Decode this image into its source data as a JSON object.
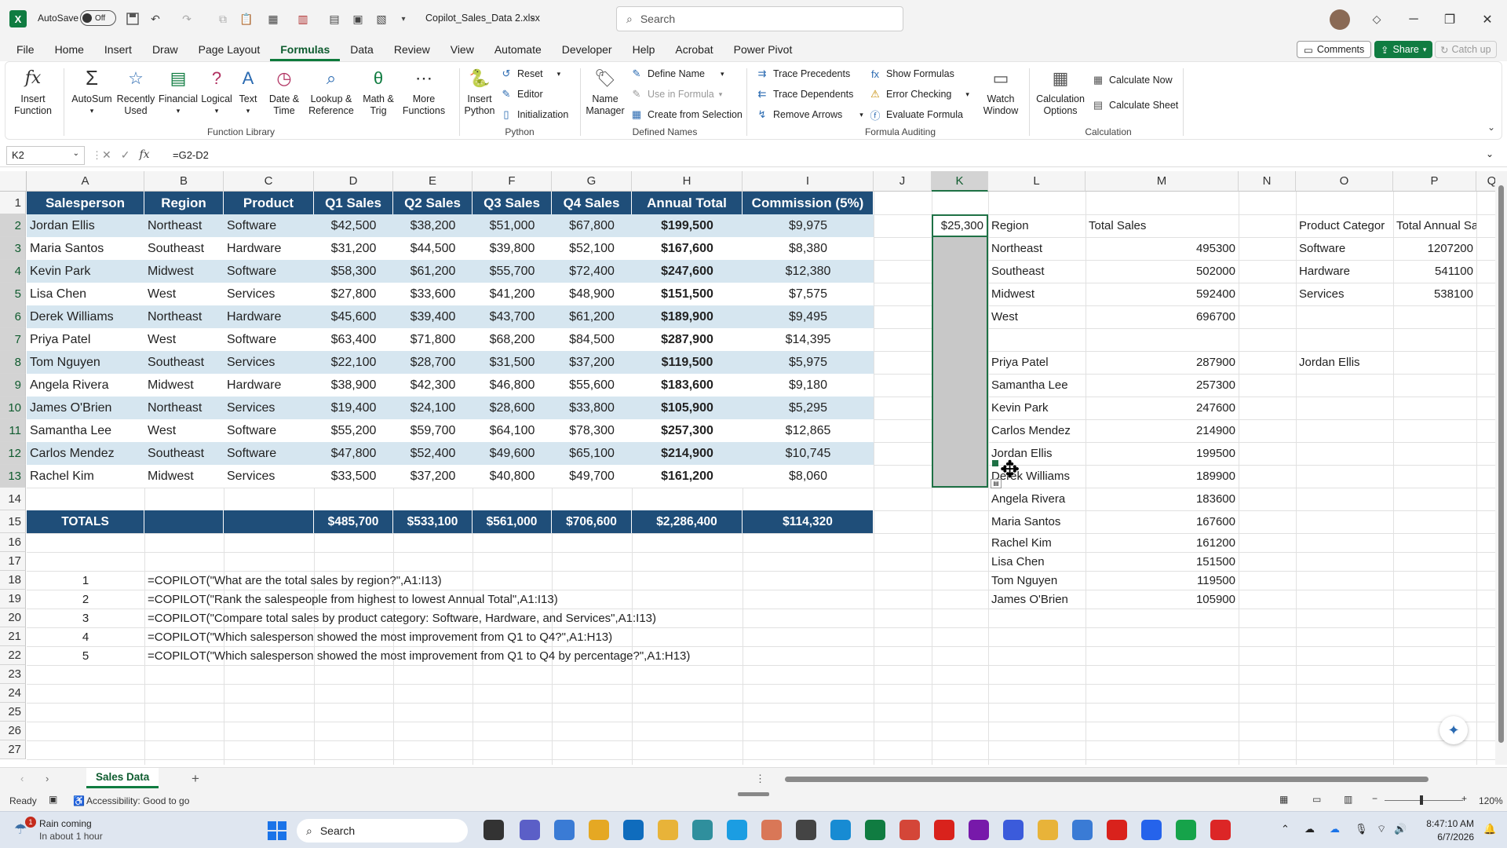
{
  "titlebar": {
    "autosave_label": "AutoSave",
    "autosave_state": "Off",
    "filename": "Copilot_Sales_Data 2.xlsx",
    "search_placeholder": "Search"
  },
  "menu": {
    "tabs": [
      "File",
      "Home",
      "Insert",
      "Draw",
      "Page Layout",
      "Formulas",
      "Data",
      "Review",
      "View",
      "Automate",
      "Developer",
      "Help",
      "Acrobat",
      "Power Pivot"
    ],
    "active": "Formulas",
    "comments": "Comments",
    "share": "Share",
    "catchup": "Catch up"
  },
  "ribbon": {
    "insert_function": [
      "Insert",
      "Function"
    ],
    "autosum": "AutoSum",
    "recently_used": [
      "Recently",
      "Used"
    ],
    "financial": "Financial",
    "logical": "Logical",
    "text": "Text",
    "date_time": [
      "Date &",
      "Time"
    ],
    "lookup": [
      "Lookup &",
      "Reference"
    ],
    "math": [
      "Math &",
      "Trig"
    ],
    "more_functions": [
      "More",
      "Functions"
    ],
    "group_function_library": "Function Library",
    "insert_python": [
      "Insert",
      "Python"
    ],
    "reset": "Reset",
    "editor": "Editor",
    "initialization": "Initialization",
    "group_python": "Python",
    "name_manager": [
      "Name",
      "Manager"
    ],
    "define_name": "Define Name",
    "use_in_formula": "Use in Formula",
    "create_from_selection": "Create from Selection",
    "group_defined_names": "Defined Names",
    "trace_precedents": "Trace Precedents",
    "trace_dependents": "Trace Dependents",
    "remove_arrows": "Remove Arrows",
    "show_formulas": "Show Formulas",
    "error_checking": "Error Checking",
    "evaluate_formula": "Evaluate Formula",
    "watch_window": [
      "Watch",
      "Window"
    ],
    "group_formula_auditing": "Formula Auditing",
    "calc_options": [
      "Calculation",
      "Options"
    ],
    "calc_now": "Calculate Now",
    "calc_sheet": "Calculate Sheet",
    "group_calculation": "Calculation"
  },
  "formula_bar": {
    "name_box": "K2",
    "fx": "fx",
    "formula": "=G2-D2"
  },
  "columns": [
    "A",
    "B",
    "C",
    "D",
    "E",
    "F",
    "G",
    "H",
    "I",
    "J",
    "K",
    "L",
    "M",
    "N",
    "O",
    "P",
    "Q"
  ],
  "rows": [
    "1",
    "2",
    "3",
    "4",
    "5",
    "6",
    "7",
    "8",
    "9",
    "10",
    "11",
    "12",
    "13",
    "14",
    "15",
    "16",
    "17",
    "18",
    "19",
    "20",
    "21",
    "22",
    "23",
    "24",
    "25",
    "26",
    "27"
  ],
  "table": {
    "headers": [
      "Salesperson",
      "Region",
      "Product",
      "Q1 Sales",
      "Q2 Sales",
      "Q3 Sales",
      "Q4 Sales",
      "Annual Total",
      "Commission (5%)"
    ],
    "rows": [
      [
        "Jordan Ellis",
        "Northeast",
        "Software",
        "$42,500",
        "$38,200",
        "$51,000",
        "$67,800",
        "$199,500",
        "$9,975"
      ],
      [
        "Maria Santos",
        "Southeast",
        "Hardware",
        "$31,200",
        "$44,500",
        "$39,800",
        "$52,100",
        "$167,600",
        "$8,380"
      ],
      [
        "Kevin Park",
        "Midwest",
        "Software",
        "$58,300",
        "$61,200",
        "$55,700",
        "$72,400",
        "$247,600",
        "$12,380"
      ],
      [
        "Lisa Chen",
        "West",
        "Services",
        "$27,800",
        "$33,600",
        "$41,200",
        "$48,900",
        "$151,500",
        "$7,575"
      ],
      [
        "Derek Williams",
        "Northeast",
        "Hardware",
        "$45,600",
        "$39,400",
        "$43,700",
        "$61,200",
        "$189,900",
        "$9,495"
      ],
      [
        "Priya Patel",
        "West",
        "Software",
        "$63,400",
        "$71,800",
        "$68,200",
        "$84,500",
        "$287,900",
        "$14,395"
      ],
      [
        "Tom Nguyen",
        "Southeast",
        "Services",
        "$22,100",
        "$28,700",
        "$31,500",
        "$37,200",
        "$119,500",
        "$5,975"
      ],
      [
        "Angela Rivera",
        "Midwest",
        "Hardware",
        "$38,900",
        "$42,300",
        "$46,800",
        "$55,600",
        "$183,600",
        "$9,180"
      ],
      [
        "James O'Brien",
        "Northeast",
        "Services",
        "$19,400",
        "$24,100",
        "$28,600",
        "$33,800",
        "$105,900",
        "$5,295"
      ],
      [
        "Samantha Lee",
        "West",
        "Software",
        "$55,200",
        "$59,700",
        "$64,100",
        "$78,300",
        "$257,300",
        "$12,865"
      ],
      [
        "Carlos Mendez",
        "Southeast",
        "Software",
        "$47,800",
        "$52,400",
        "$49,600",
        "$65,100",
        "$214,900",
        "$10,745"
      ],
      [
        "Rachel Kim",
        "Midwest",
        "Services",
        "$33,500",
        "$37,200",
        "$40,800",
        "$49,700",
        "$161,200",
        "$8,060"
      ]
    ],
    "totals": [
      "TOTALS",
      "",
      "",
      "$485,700",
      "$533,100",
      "$561,000",
      "$706,600",
      "$2,286,400",
      "$114,320"
    ]
  },
  "prompts": [
    {
      "n": "1",
      "f": "=COPILOT(\"What are the total sales by region?\",A1:I13)"
    },
    {
      "n": "2",
      "f": "=COPILOT(\"Rank the salespeople from highest to lowest Annual Total\",A1:I13)"
    },
    {
      "n": "3",
      "f": "=COPILOT(\"Compare total sales by product category: Software, Hardware, and Services\",A1:I13)"
    },
    {
      "n": "4",
      "f": "=COPILOT(\"Which salesperson showed the most improvement from Q1 to Q4?\",A1:H13)"
    },
    {
      "n": "5",
      "f": "=COPILOT(\"Which salesperson showed the most improvement from Q1 to Q4 by percentage?\",A1:H13)"
    }
  ],
  "k2_value": "$25,300",
  "region_table": {
    "headers": [
      "Region",
      "Total Sales"
    ],
    "rows": [
      [
        "Northeast",
        "495300"
      ],
      [
        "Southeast",
        "502000"
      ],
      [
        "Midwest",
        "592400"
      ],
      [
        "West",
        "696700"
      ]
    ]
  },
  "rank_list": [
    [
      "Priya Patel",
      "287900"
    ],
    [
      "Samantha Lee",
      "257300"
    ],
    [
      "Kevin Park",
      "247600"
    ],
    [
      "Carlos Mendez",
      "214900"
    ],
    [
      "Jordan Ellis",
      "199500"
    ],
    [
      "Derek Williams",
      "189900"
    ],
    [
      "Angela Rivera",
      "183600"
    ],
    [
      "Maria Santos",
      "167600"
    ],
    [
      "Rachel Kim",
      "161200"
    ],
    [
      "Lisa Chen",
      "151500"
    ],
    [
      "Tom Nguyen",
      "119500"
    ],
    [
      "James O'Brien",
      "105900"
    ]
  ],
  "product_table": {
    "headers": [
      "Product Categor",
      "Total Annual Sale"
    ],
    "rows": [
      [
        "Software",
        "1207200"
      ],
      [
        "Hardware",
        "541100"
      ],
      [
        "Services",
        "538100"
      ]
    ]
  },
  "o8_value": "Jordan Ellis",
  "sheet_tab": "Sales Data",
  "status": {
    "ready": "Ready",
    "accessibility": "Accessibility: Good to go",
    "zoom": "120%"
  },
  "taskbar": {
    "weather_title": "Rain coming",
    "weather_sub": "In about 1 hour",
    "search": "Search",
    "time": "8:47:10 AM",
    "date": "6/7/2026",
    "badge": "1"
  }
}
